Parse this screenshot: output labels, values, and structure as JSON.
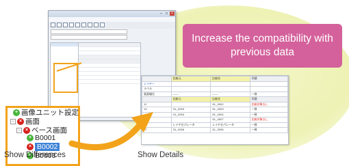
{
  "banner": {
    "text": "Increase the compatibility with previous data"
  },
  "captions": {
    "left": "Show Differences",
    "right": "Show Details"
  },
  "colors": {
    "banner": "#d4619b",
    "accent_orange": "#f2a31a",
    "highlight_yellow": "#f4f2a8",
    "diff_red": "#e0231a"
  },
  "zoom_tree": {
    "nodes": [
      {
        "label": "画像ユニット設定",
        "icon": "green-plus-icon"
      },
      {
        "label": "画面",
        "icon": "red-x-icon"
      },
      {
        "label": "ベース画面",
        "icon": "red-x-icon"
      },
      {
        "label": "B0001",
        "icon": "green-plus-icon"
      },
      {
        "label": "B0002",
        "icon": "red-x-icon"
      },
      {
        "label": "B0003",
        "icon": "green-plus-icon"
      }
    ]
  },
  "detail_table": {
    "header": [
      "",
      "比較元",
      "比較先",
      "同値"
    ],
    "top_rows": [
      [
        "レイヤー",
        "",
        "",
        ""
      ],
      [
        "ラベル",
        "",
        "",
        ""
      ],
      [
        "画面幅位",
        "——",
        "——",
        "一致"
      ]
    ],
    "sub_header": [
      "",
      "比較元",
      "比較先",
      "同値"
    ],
    "rows": [
      [
        "12",
        "",
        "GL_0002",
        "比較対象なし"
      ],
      [
        "13",
        "GL_0003",
        "GL_0003",
        "一致"
      ],
      [
        "",
        "GL_0004",
        "GL_0004",
        "一致"
      ],
      [
        "",
        "",
        "GL_0007",
        "比較対象なし"
      ],
      [
        "",
        "レイヤセパレータ",
        "レイヤセパレータ",
        "一致"
      ],
      [
        "17",
        "GL_0006",
        "GL_0006",
        "一致"
      ]
    ]
  }
}
